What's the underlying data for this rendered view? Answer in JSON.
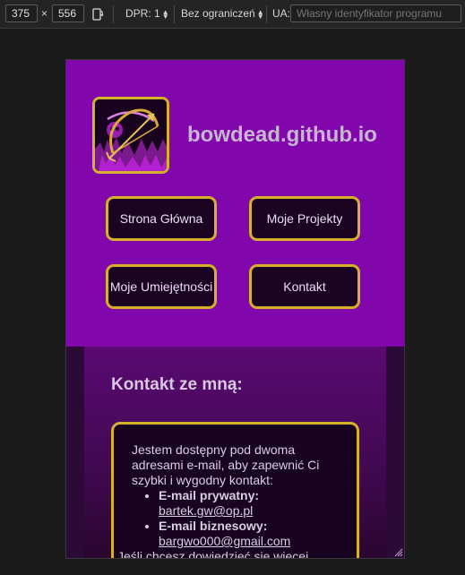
{
  "devtools": {
    "width": "375",
    "times": "×",
    "height": "556",
    "dpr_label": "DPR: 1",
    "throttle_label": "Bez ograniczeń",
    "ua_label": "UA:",
    "ua_placeholder": "Własny identyfikator programu"
  },
  "site": {
    "title": "bowdead.github.io",
    "nav": [
      {
        "label": "Strona Główna"
      },
      {
        "label": "Moje Projekty"
      },
      {
        "label": "Moje Umiejętności"
      },
      {
        "label": "Kontakt"
      }
    ]
  },
  "contact": {
    "heading": "Kontakt ze mną:",
    "intro": "Jestem dostępny pod dwoma adresami e-mail, aby zapewnić Ci szybki i wygodny kontakt:",
    "emails": [
      {
        "label": "E-mail prywatny:",
        "address": "bartek.gw@op.pl"
      },
      {
        "label": "E-mail biznesowy:",
        "address": "bargwo000@gmail.com"
      }
    ],
    "outro": "Jeśli chcesz dowiedzieć się więcej"
  },
  "colors": {
    "header_bg": "#8106ac",
    "accent_border": "#d6b12a",
    "button_bg": "#1b0422"
  }
}
